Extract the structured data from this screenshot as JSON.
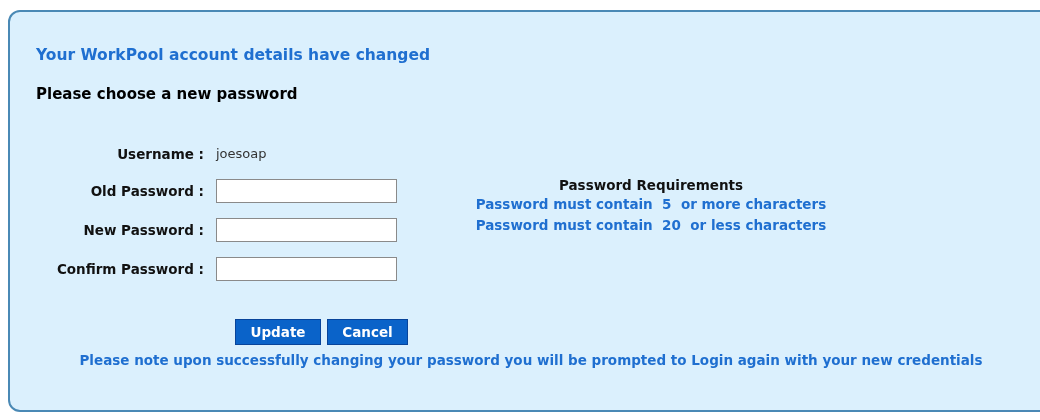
{
  "heading": "Your WorkPool account details have changed",
  "subheading": "Please choose a new password",
  "username": {
    "label": "Username :",
    "value": "joesoap"
  },
  "fields": [
    {
      "label": "Old Password :"
    },
    {
      "label": "New Password :"
    },
    {
      "label": "Confirm Password :"
    }
  ],
  "requirements": {
    "title": "Password Requirements",
    "items": [
      "Password must contain  5  or more characters",
      "Password must contain  20  or less characters"
    ]
  },
  "buttons": [
    "Update",
    "Cancel"
  ],
  "note": "Please note upon successfully changing your password you will be prompted to Login again with your new credentials"
}
